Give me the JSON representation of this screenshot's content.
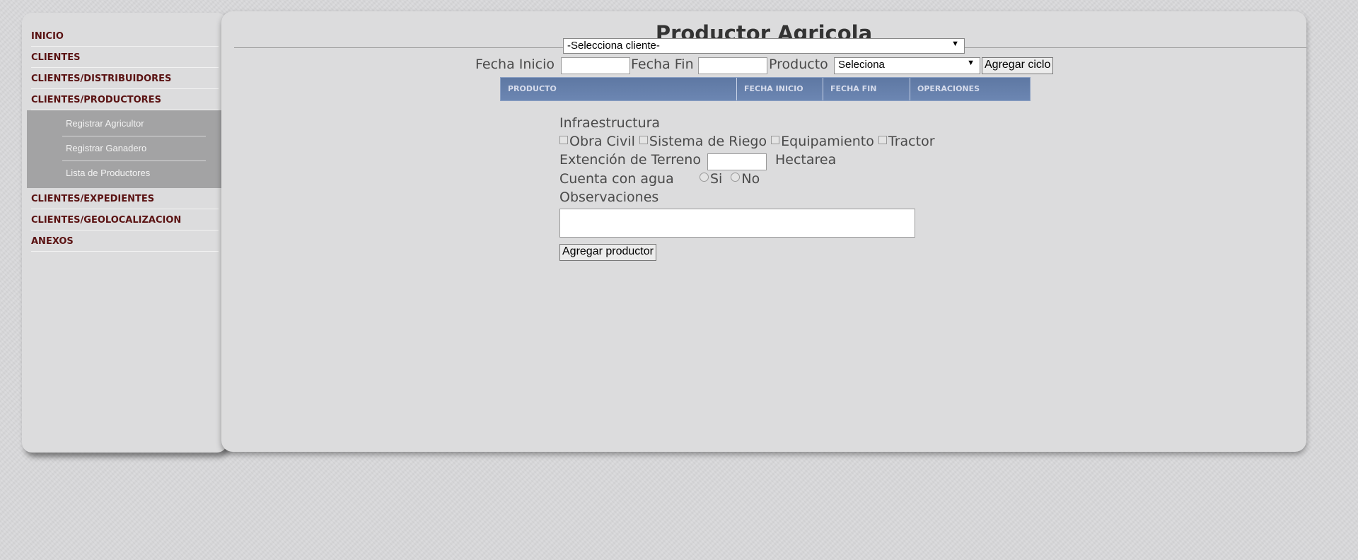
{
  "sidebar": {
    "items": [
      {
        "label": "INICIO"
      },
      {
        "label": "CLIENTES"
      },
      {
        "label": "CLIENTES/DISTRIBUIDORES"
      },
      {
        "label": "CLIENTES/PRODUCTORES"
      },
      {
        "label": "CLIENTES/EXPEDIENTES"
      },
      {
        "label": "CLIENTES/GEOLOCALIZACION"
      },
      {
        "label": "ANEXOS"
      }
    ],
    "submenu": [
      {
        "label": "Registrar Agricultor"
      },
      {
        "label": "Registrar Ganadero"
      },
      {
        "label": "Lista de Productores"
      }
    ]
  },
  "main": {
    "title": "Productor Agricola",
    "client_select": "-Selecciona cliente-",
    "fecha_inicio_label": "Fecha Inicio",
    "fecha_fin_label": "Fecha Fin",
    "producto_label": "Producto",
    "producto_select": "Seleciona",
    "agregar_ciclo": "Agregar ciclo",
    "table_headers": [
      "PRODUCTO",
      "FECHA INICIO",
      "FECHA FIN",
      "OPERACIONES"
    ],
    "infra_label": "Infraestructura",
    "checkboxes": [
      "Obra Civil",
      "Sistema de Riego",
      "Equipamiento",
      "Tractor"
    ],
    "extension_label": "Extención de Terreno",
    "hectarea_label": "Hectarea",
    "agua_label": "Cuenta con agua",
    "radio_si": "Si",
    "radio_no": "No",
    "observaciones_label": "Observaciones",
    "agregar_productor": "Agregar productor"
  },
  "colors": {
    "nav_text": "#5a1212",
    "submenu_bg": "#a3a3a4",
    "table_header_bg": "#6c86b2"
  }
}
